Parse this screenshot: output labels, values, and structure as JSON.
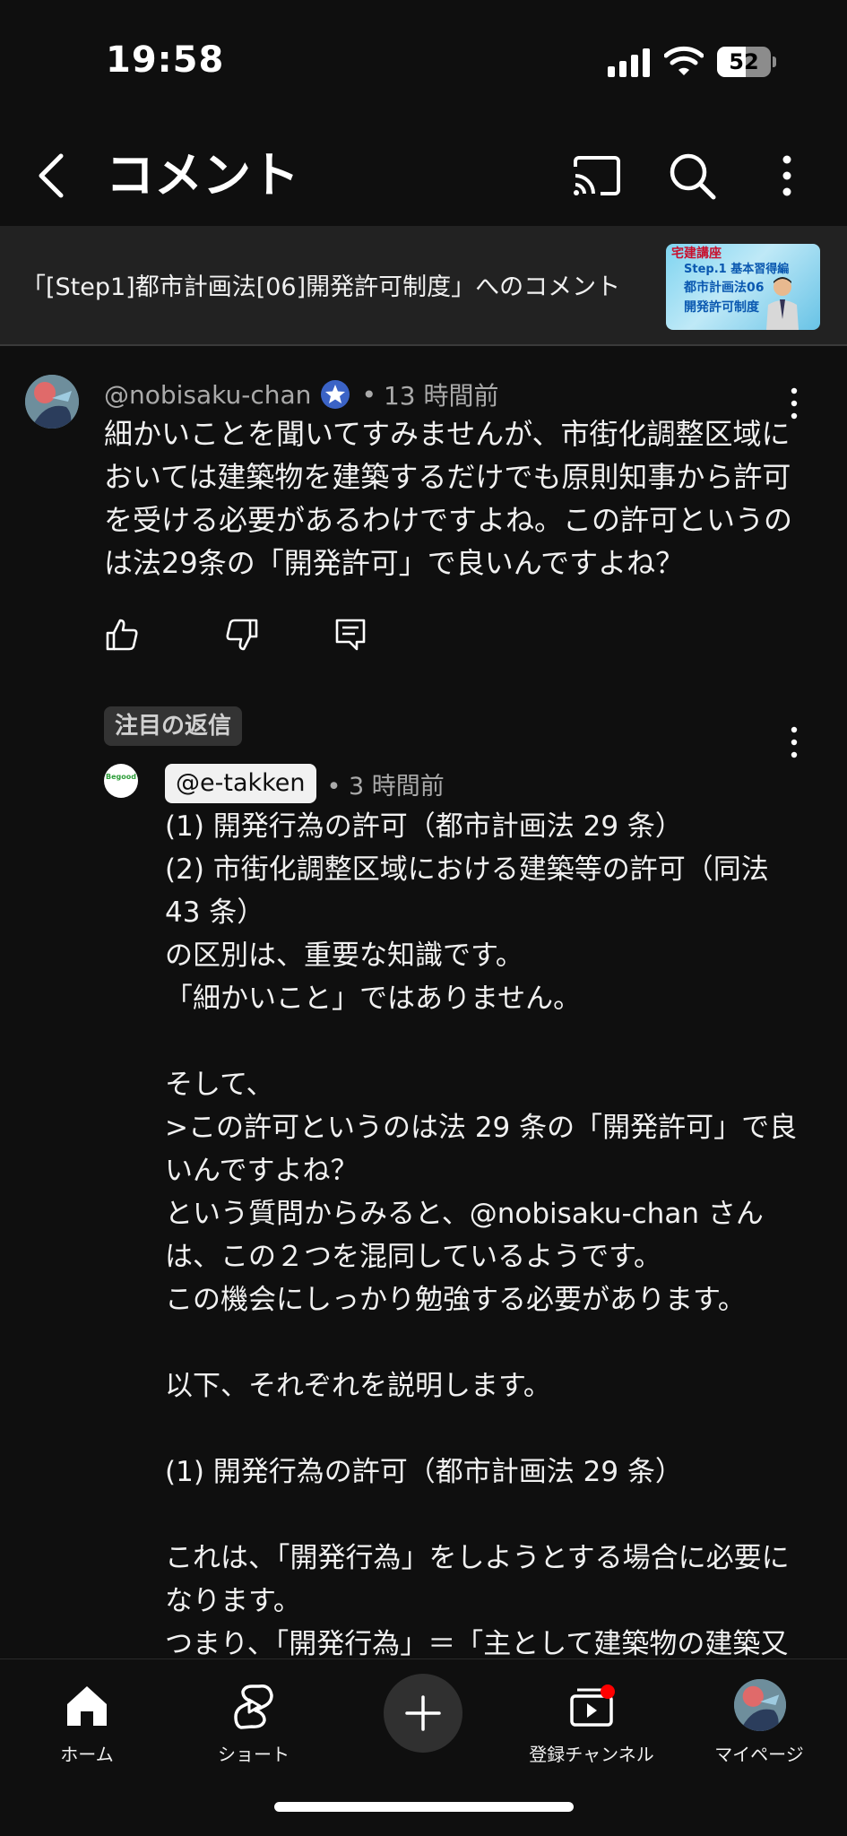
{
  "status_bar": {
    "time": "19:58",
    "battery": "52"
  },
  "header": {
    "title": "コメント"
  },
  "video": {
    "caption": "「[Step1]都市計画法[06]開発許可制度」へのコメント",
    "thumbnail_lines": [
      "宅建講座",
      "Step.1 基本習得編",
      "都市計画法06",
      "開発許可制度"
    ]
  },
  "comment": {
    "author": "@nobisaku-chan",
    "time": "13 時間前",
    "text": "細かいことを聞いてすみませんが、市街化調整区域においては建築物を建築するだけでも原則知事から許可を受ける必要があるわけですよね。この許可というのは法29条の「開発許可」で良いんですよね？"
  },
  "reply": {
    "badge": "注目の返信",
    "avatar_text": "Begood",
    "author": "@e-takken",
    "time": "3 時間前",
    "lines": [
      "(1) 開発行為の許可（都市計画法 29 条）",
      "(2) 市街化調整区域における建築等の許可（同法",
      " 43 条）",
      "の区別は、重要な知識です。",
      "「細かいこと」ではありません。",
      "",
      "そして、",
      ">この許可というのは法 29 条の「開発許可」で良",
      "いんですよね？",
      "という質問からみると、@nobisaku-chan さん",
      "は、この２つを混同しているようです。",
      "この機会にしっかり勉強する必要があります。",
      "",
      "以下、それぞれを説明します。",
      "",
      "(1) 開発行為の許可（都市計画法 29 条）",
      "",
      "これは、「開発行為」をしようとする場合に必要に",
      "なります。",
      "つまり、「開発行為」＝「主として建築物の建築又"
    ]
  },
  "bottom_nav": {
    "home": "ホーム",
    "shorts": "ショート",
    "subscriptions": "登録チャンネル",
    "mypage": "マイページ"
  },
  "colors": {
    "background": "#0f0f0f",
    "banner": "#222222",
    "verified": "#3ea6ff",
    "notification": "#ff0000"
  }
}
